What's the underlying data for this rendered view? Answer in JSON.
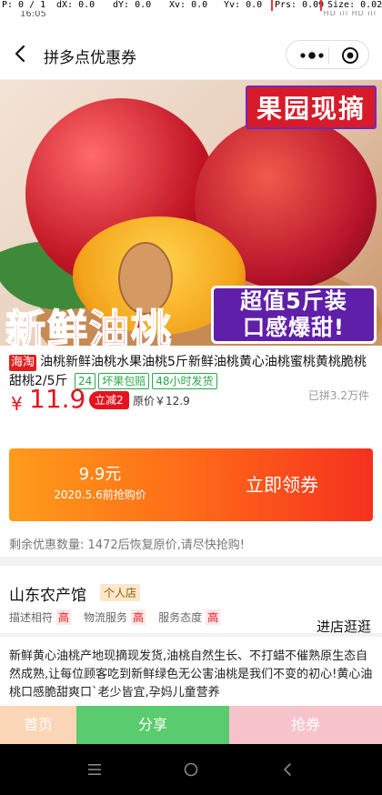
{
  "debug": {
    "p": "P: 0 / 1",
    "dx": "dX: 0.0",
    "dy": "dY: 0.0",
    "xv": "Xv: 0.0",
    "yv": "Yv: 0.0",
    "prs": "Prs: 0.09",
    "size": "Size: 0.02"
  },
  "status_bar": {
    "time": "16:05",
    "right": "HD ill HD ill"
  },
  "navbar": {
    "title": "拼多点优惠券"
  },
  "hero": {
    "tag_top": "果园现摘",
    "title": "新鲜油桃",
    "promo_line1": "超值5斤装",
    "promo_line2": "口感爆甜!"
  },
  "product": {
    "source_badge": "海淘",
    "title": "油桃新鲜油桃水果油桃5斤新鲜油桃黄心油桃蜜桃黄桃脆桃甜桃2/5斤",
    "tags": [
      "24",
      "坏果包赔",
      "48小时发货"
    ],
    "price_symbol": "¥",
    "price": "11.9",
    "discount_badge": "立减2",
    "original_price": "原价￥12.9",
    "sold": "已拼3.2万件"
  },
  "coupon": {
    "amount": "9.9元",
    "date": "2020.5.6前抢购价",
    "button": "立即领券"
  },
  "remain_text": "剩余优惠数量: 1472后恢复原价,请尽快抢购!",
  "shop": {
    "name": "山东农产馆",
    "type": "个人店",
    "ratings": [
      {
        "label": "描述相符",
        "value": "高"
      },
      {
        "label": "物流服务",
        "value": "高"
      },
      {
        "label": "服务态度",
        "value": "高"
      }
    ],
    "visit": "进店逛逛"
  },
  "description": "新鲜黄心油桃产地现摘现发货,油桃自然生长、不打蜡不催熟原生态自然成熟,让每位顾客吃到新鲜绿色无公害油桃是我们不变的初心!黄心油桃口感脆甜爽口`老少皆宜,孕妈儿童营养",
  "bottom_bar": {
    "home": "首页",
    "share": "分享",
    "coupon": "抢券"
  },
  "colors": {
    "accent": "#e5141f",
    "share_green": "#5acb6e",
    "coupon_grad_start": "#ff9c1a",
    "coupon_grad_end": "#f5311f"
  }
}
